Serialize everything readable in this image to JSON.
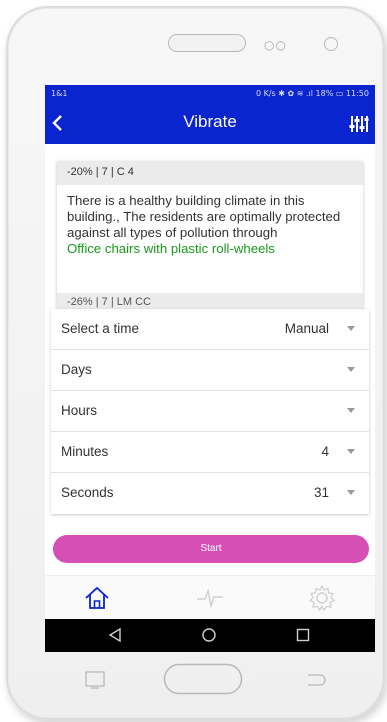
{
  "statusbar": {
    "carrier": "1&1",
    "right": "0 K/s ✱ ✿ ≋ .ıl 18% ▭ 11:50"
  },
  "appbar": {
    "title": "Vibrate",
    "back_icon": "back-chevron-icon",
    "menu_icon": "tune-sliders-icon"
  },
  "card": {
    "header": "-20% | 7 | C 4",
    "body": "There is a healthy building climate in this building., The residents are optimally protected against all types of pollution through",
    "highlight": "Office chairs with plastic roll-wheels",
    "next_header": "-26% | 7 | LM CC",
    "highlight_color": "#1b9a1b"
  },
  "form": {
    "rows": [
      {
        "label": "Select a time",
        "value": "Manual"
      },
      {
        "label": "Days",
        "value": ""
      },
      {
        "label": "Hours",
        "value": ""
      },
      {
        "label": "Minutes",
        "value": "4"
      },
      {
        "label": "Seconds",
        "value": "31"
      }
    ]
  },
  "start_button": {
    "label": "Start",
    "color": "#d54fb4"
  },
  "tabs": [
    {
      "icon": "home-icon",
      "active": true
    },
    {
      "icon": "pulse-icon",
      "active": false
    },
    {
      "icon": "gear-icon",
      "active": false
    }
  ],
  "colors": {
    "primary": "#0a24cf",
    "accent": "#d54fb4"
  }
}
